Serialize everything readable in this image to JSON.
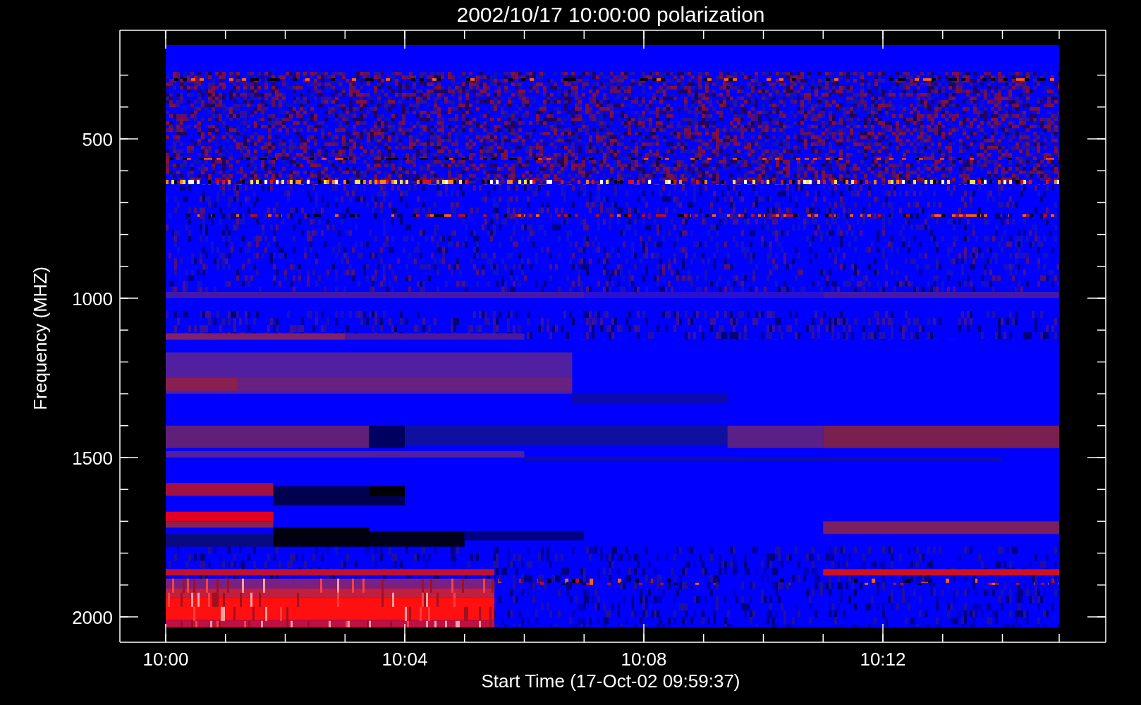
{
  "title": "2002/10/17 10:00:00 polarization",
  "y_axis": {
    "label": "Frequency (MHZ)",
    "ticks": [
      "500",
      "1000",
      "1500",
      "2000"
    ]
  },
  "x_axis": {
    "label": "Start Time (17-Oct-02 09:59:37)",
    "ticks": [
      "10:00",
      "10:04",
      "10:08",
      "10:12"
    ]
  }
}
